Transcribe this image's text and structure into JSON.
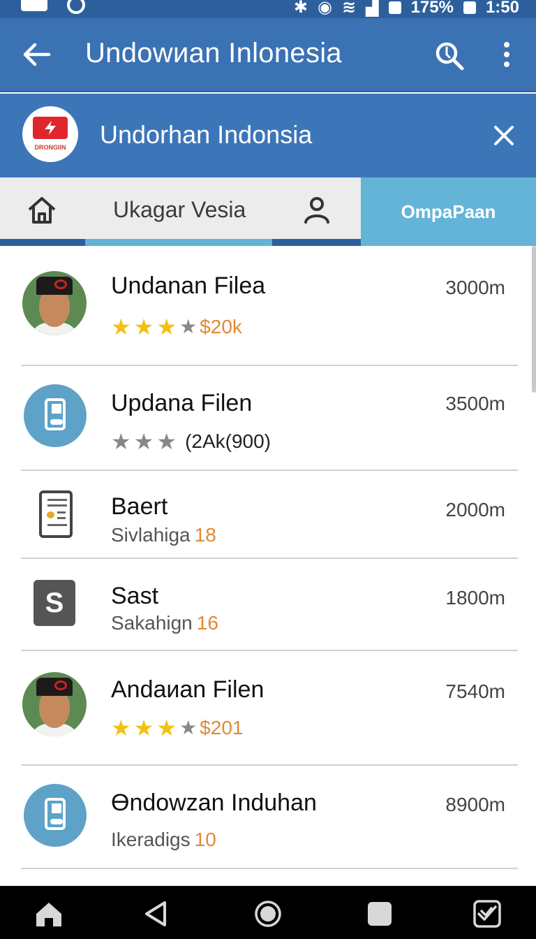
{
  "status_bar": {
    "battery_text": "175%",
    "time": "1:50"
  },
  "app_bar": {
    "title": "Undowиan Inlonesia"
  },
  "sub_header": {
    "logo_text": "DRONGIIN",
    "title": "Undorhan Indonsia"
  },
  "tabs": {
    "middle_label": "Ukagar Vesia",
    "active_label": "OmpaPaan"
  },
  "colors": {
    "app_bar": "#3a72b4",
    "status_bar": "#2c5f9c",
    "tab_active": "#64b4d8",
    "accent_orange": "#e08a34",
    "star_gold": "#f2c010"
  },
  "list": [
    {
      "avatar": "person-avatar",
      "title": "Undanan Filea",
      "size": "3000m",
      "stars_gold": 3,
      "stars_gray": 1,
      "price": "$20k"
    },
    {
      "avatar": "device-icon",
      "title": "Updana Filen",
      "size": "3500m",
      "stars_gold": 0,
      "stars_gray": 3,
      "count": "(2Ak(900)"
    },
    {
      "avatar": "document-icon",
      "title": "Baert",
      "size": "2000m",
      "sub_label": "Sivlahiga",
      "sub_number": "18"
    },
    {
      "avatar": "s-icon",
      "title": "Sast",
      "size": "1800m",
      "sub_label": "Sakahign",
      "sub_number": "16"
    },
    {
      "avatar": "person-avatar",
      "title": "Andaиan Filen",
      "size": "7540m",
      "stars_gold": 3,
      "stars_gray": 1,
      "price": "$201"
    },
    {
      "avatar": "device-icon",
      "title": "Ɵndowzan Induhan",
      "size": "8900m",
      "sub_label": "Ikeradigs",
      "sub_number": "10"
    }
  ]
}
